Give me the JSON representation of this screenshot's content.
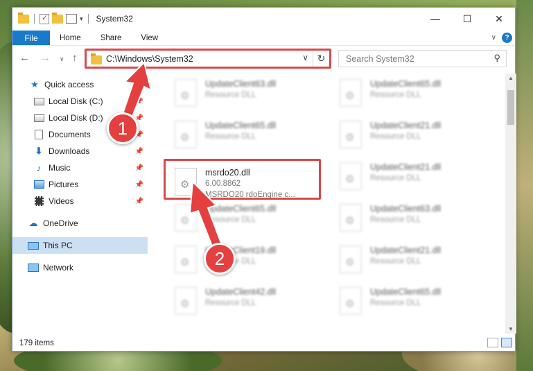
{
  "window": {
    "title": "System32",
    "controls": {
      "minimize": "—",
      "maximize": "☐",
      "close": "✕"
    }
  },
  "ribbon": {
    "file": "File",
    "tabs": [
      "Home",
      "Share",
      "View"
    ],
    "expand": "∨",
    "help": "?"
  },
  "address": {
    "path": "C:\\Windows\\System32",
    "refresh": "↻",
    "search_placeholder": "Search System32"
  },
  "nav": {
    "back": "←",
    "forward": "→",
    "recent": "∨",
    "up": "↑",
    "items": [
      {
        "label": "Quick access",
        "icon": "star-icon"
      },
      {
        "label": "Local Disk (C:)",
        "icon": "drive-icon",
        "pinned": true
      },
      {
        "label": "Local Disk (D:)",
        "icon": "drive-icon",
        "pinned": true
      },
      {
        "label": "Documents",
        "icon": "documents-icon",
        "pinned": true
      },
      {
        "label": "Downloads",
        "icon": "download-icon",
        "pinned": true
      },
      {
        "label": "Music",
        "icon": "music-icon",
        "pinned": true
      },
      {
        "label": "Pictures",
        "icon": "pictures-icon",
        "pinned": true
      },
      {
        "label": "Videos",
        "icon": "videos-icon",
        "pinned": true
      },
      {
        "label": "OneDrive",
        "icon": "onedrive-icon"
      },
      {
        "label": "This PC",
        "icon": "computer-icon",
        "selected": true
      },
      {
        "label": "Network",
        "icon": "network-icon"
      }
    ]
  },
  "files": [
    {
      "name": "UpdateClient63.dll",
      "desc": "Resource DLL"
    },
    {
      "name": "UpdateClient65.dll",
      "desc": "Resource DLL"
    },
    {
      "name": "UpdateClient65.dll",
      "desc": "Resource DLL"
    },
    {
      "name": "UpdateClient21.dll",
      "desc": "Resource DLL"
    },
    {
      "name": "msrdo20.dll",
      "desc": "6.00.8862",
      "desc2": "MSRDO20 rdoEngine c..."
    },
    {
      "name": "UpdateClient21.dll",
      "desc": "Resource DLL"
    },
    {
      "name": "UpdateClient65.dll",
      "desc": "Resource DLL"
    },
    {
      "name": "UpdateClient63.dll",
      "desc": "Resource DLL"
    },
    {
      "name": "UpdateClient19.dll",
      "desc": "Resource DLL"
    },
    {
      "name": "UpdateClient21.dll",
      "desc": "Resource DLL"
    },
    {
      "name": "UpdateClient42.dll",
      "desc": "Resource DLL"
    },
    {
      "name": "UpdateClient65.dll",
      "desc": "Resource DLL"
    }
  ],
  "status": {
    "count": "179 items"
  },
  "annotations": {
    "step1": "1",
    "step2": "2"
  },
  "colors": {
    "accent": "#1979ca",
    "highlight": "#d9474a",
    "selected": "#cce0f4"
  }
}
